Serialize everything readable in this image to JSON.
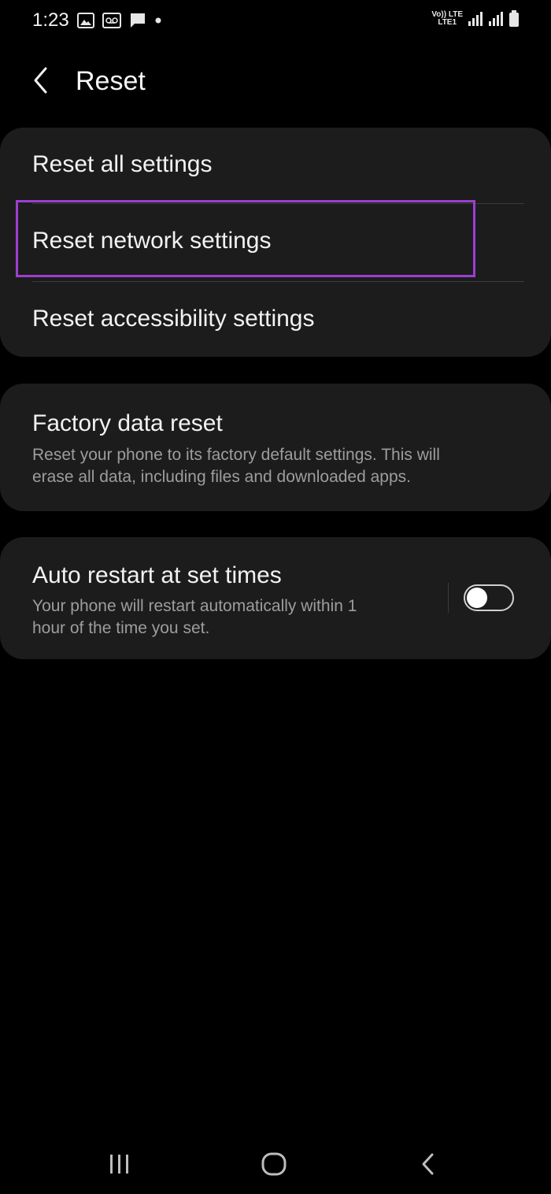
{
  "status_bar": {
    "time": "1:23",
    "network_label_top": "Vo)) LTE",
    "network_label_bottom": "LTE1"
  },
  "header": {
    "title": "Reset"
  },
  "reset_options": {
    "reset_all_label": "Reset all settings",
    "reset_network_label": "Reset network settings",
    "reset_accessibility_label": "Reset accessibility settings"
  },
  "factory_reset": {
    "title": "Factory data reset",
    "description_line1": "Reset your phone to its factory default settings. This will",
    "description_line2": "erase all data, including files and downloaded apps."
  },
  "auto_restart": {
    "title": "Auto restart at set times",
    "description_line1": "Your phone will restart automatically within 1",
    "description_line2": "hour of the time you set.",
    "enabled": false
  },
  "colors": {
    "background": "#000000",
    "card": "#1c1c1c",
    "highlight": "#9b3fd0",
    "secondary_text": "#9d9d9d"
  },
  "icons": {
    "back": "chevron-left-icon",
    "recents": "recents-icon",
    "home": "home-icon",
    "nav_back": "nav-back-icon"
  }
}
